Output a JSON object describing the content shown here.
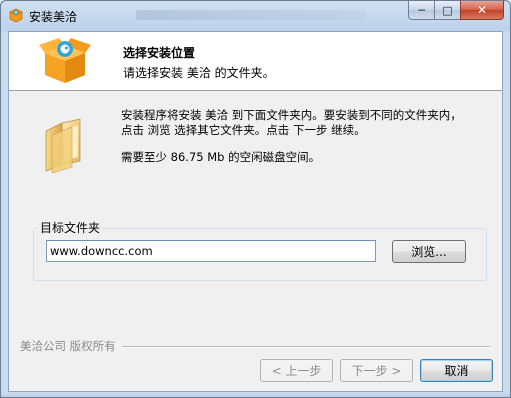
{
  "window": {
    "title": "安装美洽",
    "controls": {
      "minimize": "─",
      "maximize": "□",
      "close": "✕"
    }
  },
  "header": {
    "title": "选择安装位置",
    "subtitle": "请选择安装 美洽 的文件夹。"
  },
  "body": {
    "description_line1": "安装程序将安装 美洽 到下面文件夹内。要安装到不同的文件夹内，",
    "description_line2": "点击 浏览 选择其它文件夹。点击 下一步 继续。",
    "space_required": "需要至少 86.75 Mb 的空闲磁盘空间。"
  },
  "destination": {
    "label": "目标文件夹",
    "path": "www.downcc.com",
    "browse_label": "浏览..."
  },
  "footer": {
    "brand": "美洽公司 版权所有",
    "back_label": "< 上一步",
    "next_label": "下一步 >",
    "cancel_label": "取消"
  },
  "colors": {
    "title_bar": "#c4d7ec",
    "close_button": "#c9452b",
    "focus_border": "#3c7fb1"
  },
  "icons": {
    "app": "orange-box-icon",
    "header": "orange-box-logo-icon",
    "folder": "folder-icon"
  }
}
